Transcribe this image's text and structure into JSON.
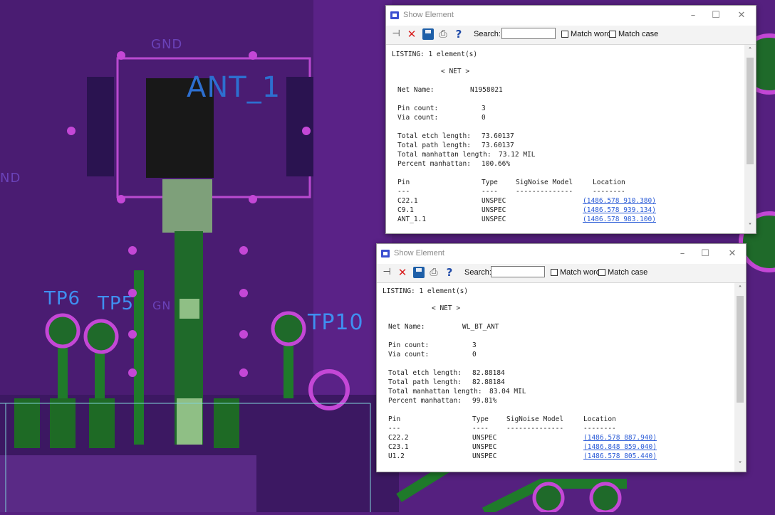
{
  "pcb": {
    "labels": {
      "gnd": "GND",
      "ant": "ANT_1",
      "tp6": "TP6",
      "tp5": "TP5",
      "tp10": "TP10",
      "gnd_left": "ND",
      "gnd_mid": "GN"
    }
  },
  "windows": [
    {
      "title": "Show Element",
      "buttons": {
        "minimize": "–",
        "maximize": "☐",
        "close": "✕"
      },
      "toolbar": {
        "search_label": "Search:",
        "search_value": "",
        "match_word": "Match word",
        "match_case": "Match case"
      },
      "listing": "LISTING: 1 element(s)",
      "section": "< NET >",
      "net_name_label": "Net Name:",
      "net_name": "N1958021",
      "pin_count_label": "Pin count:",
      "pin_count": "3",
      "via_count_label": "Via count:",
      "via_count": "0",
      "etch_label": "Total etch length:",
      "etch": "73.60137",
      "path_label": "Total path length:",
      "path": "73.60137",
      "manhattan_label": "Total manhattan length:",
      "manhattan": "73.12 MIL",
      "percent_label": "Percent manhattan:",
      "percent": "100.66%",
      "col_pin": "Pin",
      "col_type": "Type",
      "col_model": "SigNoise Model",
      "col_location": "Location",
      "dash_pin": "---",
      "dash_type": "----",
      "dash_model": "--------------",
      "dash_location": "--------",
      "rows": [
        {
          "pin": "C22.1",
          "type": "UNSPEC",
          "location": "(1486.578 910.380)"
        },
        {
          "pin": "C9.1",
          "type": "UNSPEC",
          "location": "(1486.578 939.134)"
        },
        {
          "pin": "ANT_1.1",
          "type": "UNSPEC",
          "location": "(1486.578 983.100)"
        }
      ]
    },
    {
      "title": "Show Element",
      "buttons": {
        "minimize": "–",
        "maximize": "☐",
        "close": "✕"
      },
      "toolbar": {
        "search_label": "Search:",
        "search_value": "",
        "match_word": "Match word",
        "match_case": "Match case"
      },
      "listing": "LISTING: 1 element(s)",
      "section": "< NET >",
      "net_name_label": "Net Name:",
      "net_name": "WL_BT_ANT",
      "pin_count_label": "Pin count:",
      "pin_count": "3",
      "via_count_label": "Via count:",
      "via_count": "0",
      "etch_label": "Total etch length:",
      "etch": "82.88184",
      "path_label": "Total path length:",
      "path": "82.88184",
      "manhattan_label": "Total manhattan length:",
      "manhattan": "83.04 MIL",
      "percent_label": "Percent manhattan:",
      "percent": "99.81%",
      "col_pin": "Pin",
      "col_type": "Type",
      "col_model": "SigNoise Model",
      "col_location": "Location",
      "dash_pin": "---",
      "dash_type": "----",
      "dash_model": "--------------",
      "dash_location": "--------",
      "rows": [
        {
          "pin": "C22.2",
          "type": "UNSPEC",
          "location": "(1486.578 887.940)"
        },
        {
          "pin": "C23.1",
          "type": "UNSPEC",
          "location": "(1486.848 859.040)"
        },
        {
          "pin": "U1.2",
          "type": "UNSPEC",
          "location": "(1486.578 805.440)"
        }
      ]
    }
  ],
  "colors": {
    "board": "#55207f",
    "copper": "#3a1a5c",
    "trace_green": "#1f7a2a",
    "via": "#c447d6",
    "label_blue": "#3f8ff0",
    "link": "#2a5bd7"
  }
}
